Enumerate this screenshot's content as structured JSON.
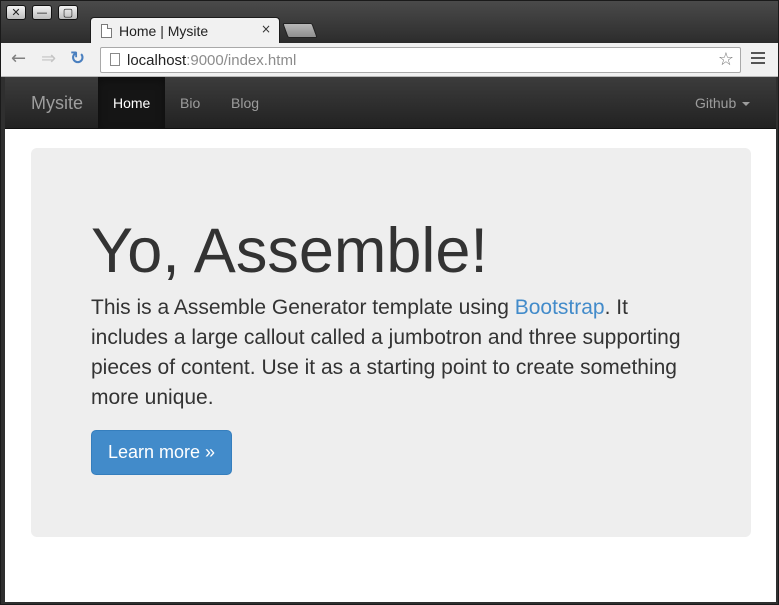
{
  "window": {
    "close_glyph": "✕",
    "minimize_glyph": "—",
    "maximize_glyph": "▢"
  },
  "tab": {
    "title": "Home | Mysite",
    "close_glyph": "×"
  },
  "toolbar": {
    "back_glyph": "←",
    "forward_glyph": "⇒",
    "reload_glyph": "↻",
    "url_host": "localhost",
    "url_rest": ":9000/index.html",
    "star_glyph": "☆"
  },
  "navbar": {
    "brand": "Mysite",
    "items": [
      {
        "label": "Home",
        "active": true
      },
      {
        "label": "Bio",
        "active": false
      },
      {
        "label": "Blog",
        "active": false
      }
    ],
    "dropdown_label": "Github"
  },
  "jumbotron": {
    "heading": "Yo, Assemble!",
    "lead_before": "This is a Assemble Generator template using ",
    "lead_link": "Bootstrap",
    "lead_after": ". It includes a large callout called a jumbotron and three supporting pieces of content. Use it as a starting point to create something more unique.",
    "button_label": "Learn more »"
  },
  "colors": {
    "navbar_bg": "#222222",
    "link": "#428bca",
    "primary_button": "#428bca",
    "jumbotron_bg": "#eeeeee"
  },
  "icons": [
    "close-icon",
    "minimize-icon",
    "maximize-icon",
    "page-icon",
    "back-arrow-icon",
    "forward-arrow-icon",
    "reload-icon",
    "bookmark-star-icon",
    "menu-icon",
    "caret-down-icon"
  ]
}
